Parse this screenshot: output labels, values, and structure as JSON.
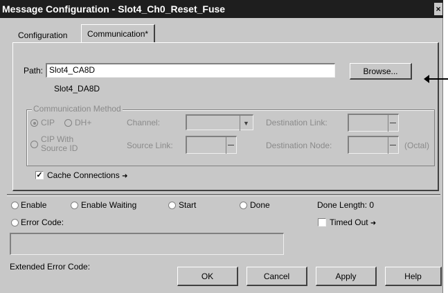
{
  "window": {
    "title": "Message Configuration - Slot4_Ch0_Reset_Fuse",
    "close_glyph": "×"
  },
  "tabs": [
    {
      "label": "Configuration"
    },
    {
      "label": "Communication*"
    }
  ],
  "path": {
    "label": "Path:",
    "value": "Slot4_CA8D",
    "resolved": "Slot4_DA8D",
    "browse_label": "Browse..."
  },
  "comm_method": {
    "title": "Communication Method",
    "cip_label": "CIP",
    "dhplus_label": "DH+",
    "channel_label": "Channel:",
    "dest_link_label": "Destination Link:",
    "cip_source_label_line1": "CIP With",
    "cip_source_label_line2": "Source ID",
    "source_link_label": "Source Link:",
    "dest_node_label": "Destination Node:",
    "octal_label": "(Octal)"
  },
  "cache": {
    "label": "Cache Connections",
    "checked": true,
    "arrow_glyph": "➜"
  },
  "status": {
    "enable": "Enable",
    "enable_waiting": "Enable Waiting",
    "start": "Start",
    "done": "Done",
    "done_length": "Done Length: 0",
    "error_code": "Error Code:",
    "timed_out": "Timed Out",
    "timed_out_arrow": "➜",
    "extended_error": "Extended Error Code:"
  },
  "buttons": {
    "ok": "OK",
    "cancel": "Cancel",
    "apply": "Apply",
    "help": "Help"
  }
}
